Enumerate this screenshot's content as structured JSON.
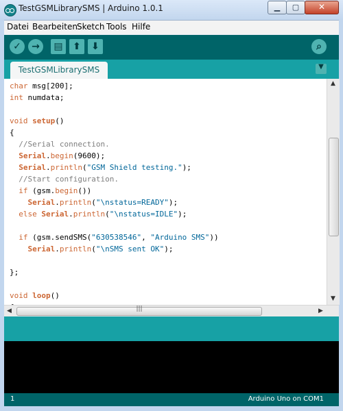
{
  "window": {
    "title": "TestGSMLibrarySMS | Arduino 1.0.1"
  },
  "menu": [
    "Datei",
    "Bearbeiten",
    "Sketch",
    "Tools",
    "Hilfe"
  ],
  "toolbar": {
    "icons": [
      "verify-icon",
      "upload-icon",
      "new-icon",
      "open-icon",
      "save-icon",
      "serial-monitor-icon"
    ]
  },
  "tabs": [
    {
      "label": "TestGSMLibrarySMS"
    }
  ],
  "editor": {
    "code": [
      "char msg[200];",
      "int numdata;",
      "",
      "void setup()",
      "{",
      "  //Serial connection.",
      "  Serial.begin(9600);",
      "  Serial.println(\"GSM Shield testing.\");",
      "  //Start configuration.",
      "  if (gsm.begin())",
      "    Serial.println(\"\\nstatus=READY\");",
      "  else Serial.println(\"\\nstatus=IDLE\");",
      "",
      "  if (gsm.sendSMS(\"630538546\", \"Arduino SMS\"))",
      "    Serial.println(\"\\nSMS sent OK\");",
      "",
      "};",
      "",
      "void loop()",
      "{"
    ]
  },
  "footer": {
    "line": "1",
    "board": "Arduino Uno on COM1"
  },
  "colors": {
    "toolbar": "#006468",
    "tabbar": "#17a1a5",
    "keyword": "#cc6633",
    "string": "#006699",
    "comment": "#7e7e7e"
  }
}
